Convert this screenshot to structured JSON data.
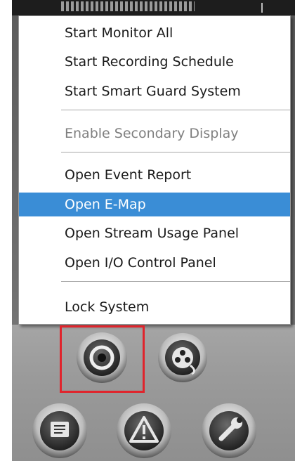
{
  "menu": {
    "items": [
      {
        "label": "Start Monitor All",
        "state": "enabled"
      },
      {
        "label": "Start Recording Schedule",
        "state": "enabled"
      },
      {
        "label": "Start Smart Guard System",
        "state": "enabled"
      },
      {
        "label": "Enable Secondary Display",
        "state": "disabled"
      },
      {
        "label": "Open Event Report",
        "state": "enabled"
      },
      {
        "label": "Open E-Map",
        "state": "selected"
      },
      {
        "label": "Open Stream Usage Panel",
        "state": "enabled"
      },
      {
        "label": "Open I/O Control Panel",
        "state": "enabled"
      },
      {
        "label": "Lock System",
        "state": "enabled"
      }
    ]
  },
  "icons": {
    "record": "record-icon",
    "playback": "playback-reel-icon",
    "event_report": "report-icon",
    "alert": "warning-icon",
    "settings": "wrench-icon"
  },
  "colors": {
    "selection": "#3a8dd6",
    "highlight_box": "#e0242c",
    "disabled_text": "#7f7f7f"
  }
}
